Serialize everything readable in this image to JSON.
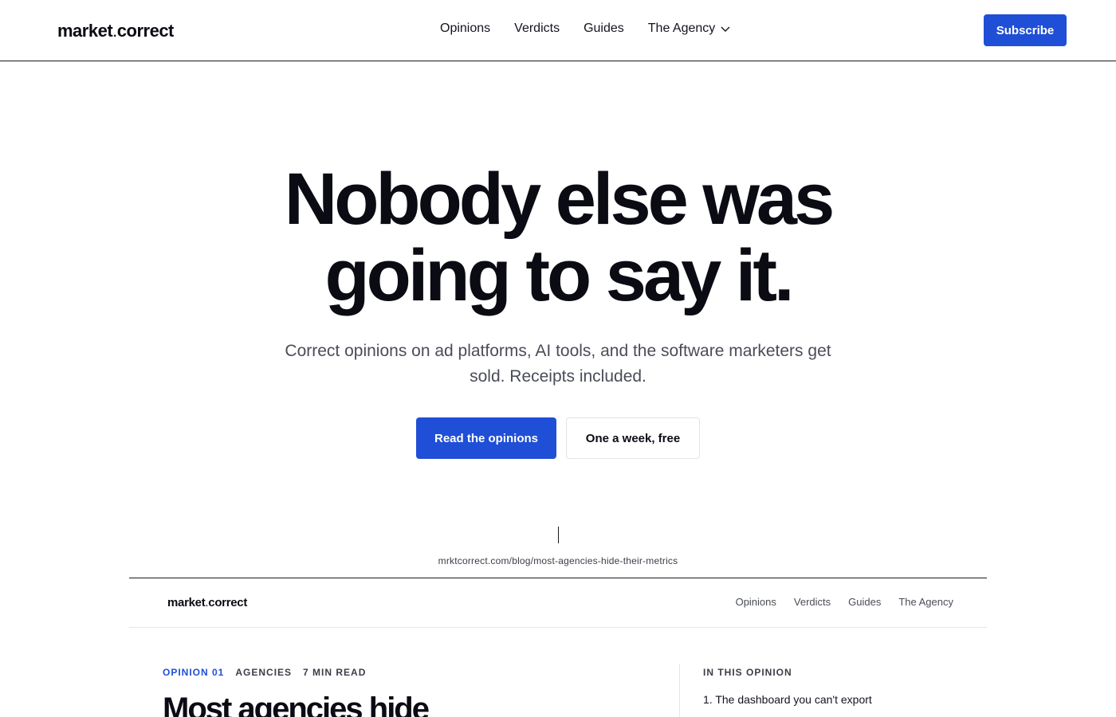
{
  "header": {
    "logo_main": "market",
    "logo_dot": ".",
    "logo_tail": "correct",
    "nav": [
      "Opinions",
      "Verdicts",
      "Guides",
      "The Agency"
    ],
    "subscribe_label": "Subscribe"
  },
  "hero": {
    "title_line1": "Nobody else was",
    "title_line2": "going to say it.",
    "subtitle": "Correct opinions on ad platforms, AI tools, and the software marketers get sold. Receipts included.",
    "primary_cta": "Read the opinions",
    "secondary_cta": "One a week, free"
  },
  "preview": {
    "url": "mrktcorrect.com/blog/most-agencies-hide-their-metrics",
    "logo_main": "market",
    "logo_dot": ".",
    "logo_tail": "correct",
    "nav": [
      "Opinions",
      "Verdicts",
      "Guides",
      "The Agency"
    ],
    "meta": {
      "opinion": "OPINION 01",
      "category": "AGENCIES",
      "read_time": "7 MIN READ"
    },
    "headline": "Most agencies hide",
    "toc_label": "IN THIS OPINION",
    "toc_items": [
      "1. The dashboard you can't export"
    ]
  },
  "colors": {
    "accent": "#1f4fd6",
    "text": "#0b0b14",
    "muted": "#4a4d57"
  }
}
